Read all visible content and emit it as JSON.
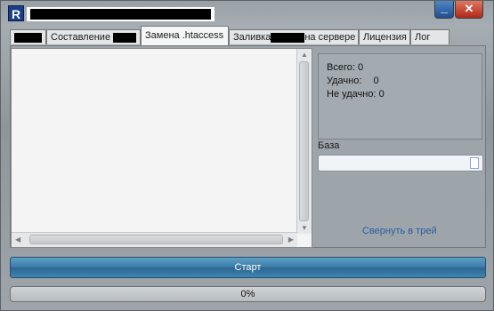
{
  "window": {
    "icon_glyph": "R",
    "minimize_glyph": "_",
    "close_glyph": "✕"
  },
  "tabs": [
    {
      "label": "",
      "redacted": true
    },
    {
      "label": "Составление"
    },
    {
      "label": "Замена .htaccess",
      "active": true
    },
    {
      "label": "Заливка",
      "suffix": "на сервере"
    },
    {
      "label": "Лицензия"
    },
    {
      "label": "Лог"
    }
  ],
  "stats": {
    "total_label": "Всего:",
    "total": "0",
    "ok_label": "Удачно:",
    "ok": "0",
    "fail_label": "Не удачно:",
    "fail": "0"
  },
  "base": {
    "label": "База",
    "value": ""
  },
  "tray_link": "Свернуть в трей",
  "start_label": "Старт",
  "progress": {
    "value": 0,
    "label": "0%"
  },
  "colors": {
    "accent": "#3f86b3",
    "link": "#2a5da0",
    "close": "#b0271a"
  }
}
